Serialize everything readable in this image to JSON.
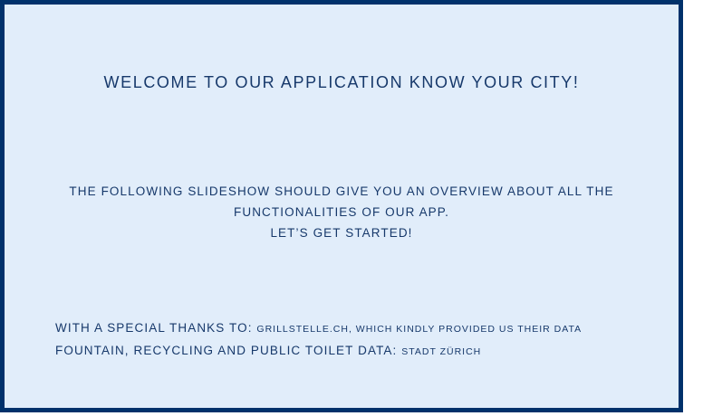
{
  "slide": {
    "title": "WELCOME TO OUR APPLICATION KNOW YOUR CITY!",
    "intro": {
      "line1": "THE FOLLOWING SLIDESHOW SHOULD GIVE YOU AN OVERVIEW ABOUT ALL THE",
      "line2": "FUNCTIONALITIES OF OUR APP.",
      "line3": "LET’S GET STARTED!"
    },
    "credits": {
      "thanks_label": "WITH A SPECIAL THANKS TO:",
      "thanks_value": "GRILLSTELLE.CH, WHICH KINDLY PROVIDED US THEIR DATA",
      "data_label": "FOUNTAIN, RECYCLING AND PUBLIC TOILET DATA:",
      "data_value": "STADT ZÜRICH"
    },
    "colors": {
      "background": "#e1edfa",
      "border": "#00316b",
      "text": "#17396b"
    }
  }
}
